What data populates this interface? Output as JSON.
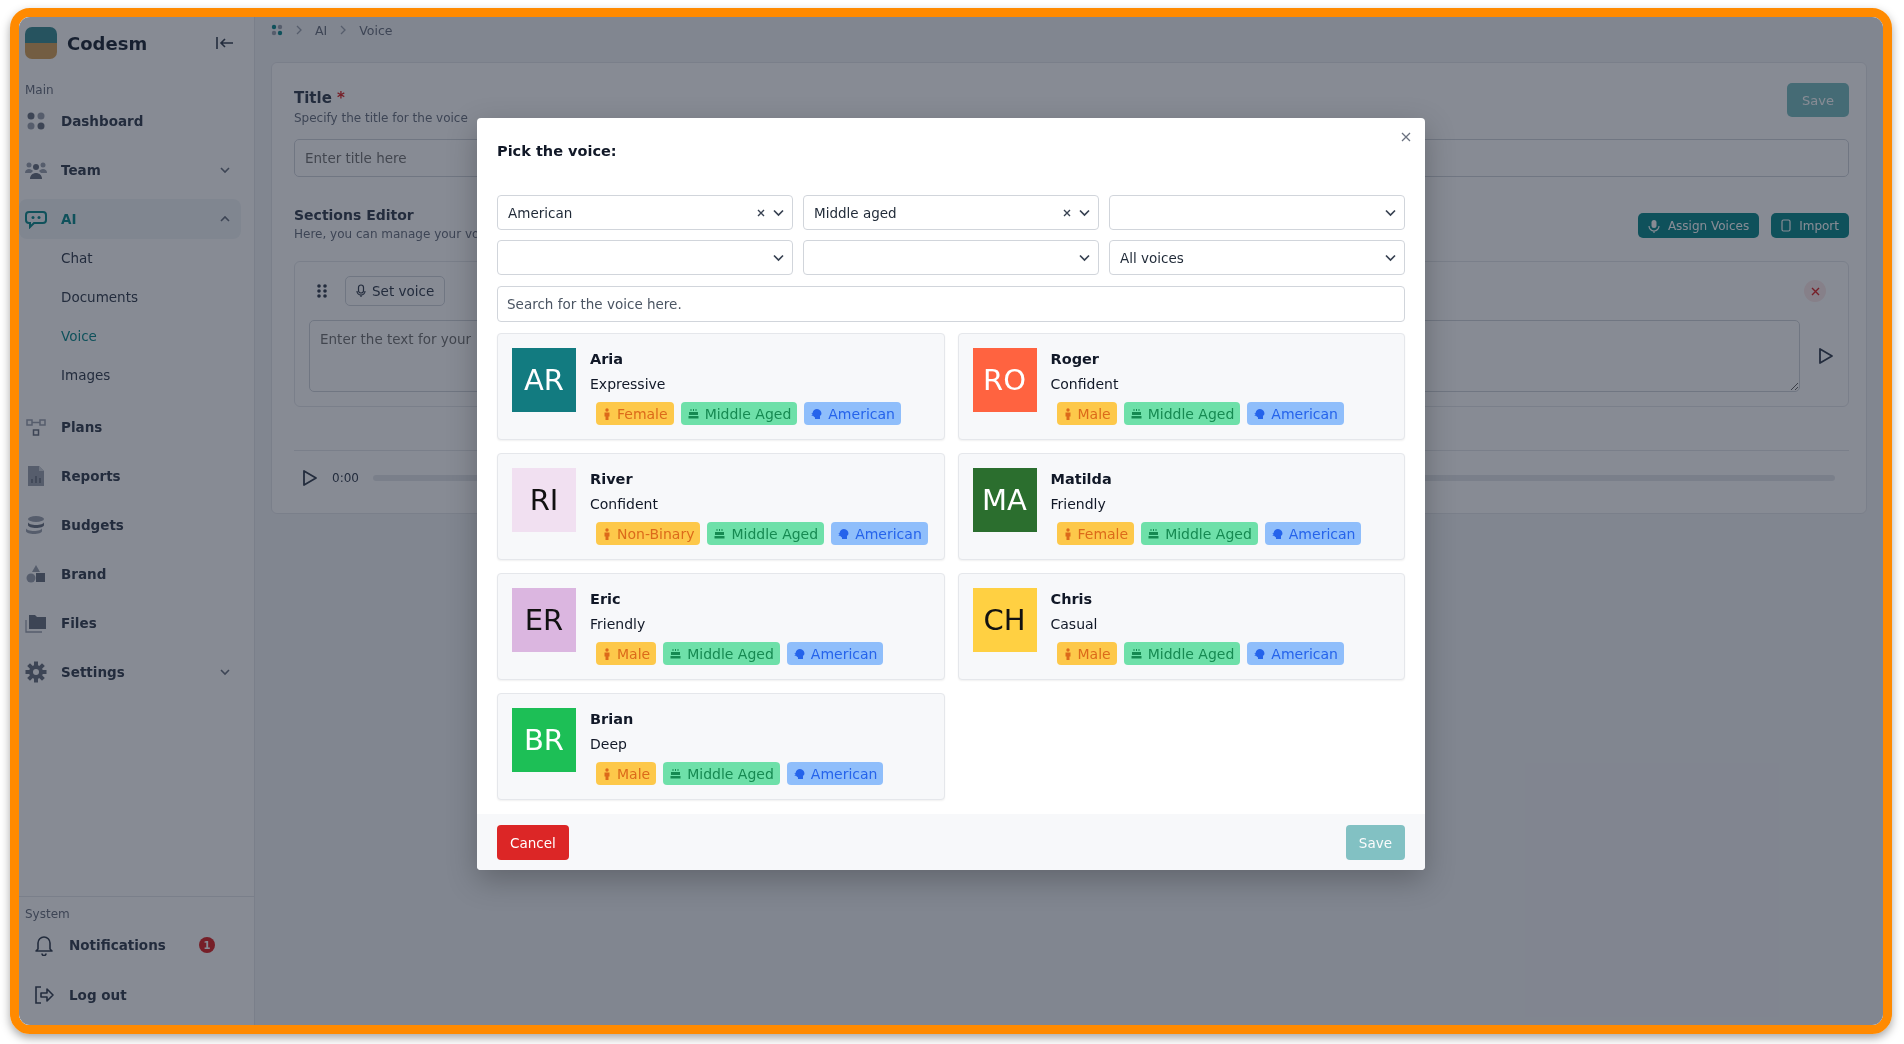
{
  "sidebar": {
    "brand": "Codesm",
    "sections": [
      {
        "title": "Main",
        "items": [
          {
            "label": "Dashboard",
            "selected": false
          },
          {
            "label": "Team",
            "selected": false,
            "expanded": false
          },
          {
            "label": "AI",
            "selected": true,
            "expanded": true,
            "children": [
              {
                "label": "Chat",
                "selected": false
              },
              {
                "label": "Documents",
                "selected": false
              },
              {
                "label": "Voice",
                "selected": true
              },
              {
                "label": "Images",
                "selected": false
              }
            ]
          },
          {
            "label": "Plans",
            "selected": false
          },
          {
            "label": "Reports",
            "selected": false
          },
          {
            "label": "Budgets",
            "selected": false
          },
          {
            "label": "Brand",
            "selected": false
          },
          {
            "label": "Files",
            "selected": false
          },
          {
            "label": "Settings",
            "selected": false,
            "expanded": false
          }
        ]
      },
      {
        "title": "System",
        "items": [
          {
            "label": "Notifications",
            "badge": "1"
          },
          {
            "label": "Log out"
          }
        ]
      }
    ]
  },
  "breadcrumb": [
    "AI",
    "Voice"
  ],
  "editor": {
    "title_label": "Title",
    "required_mark": "*",
    "title_hint": "Specify the title for the voice",
    "title_placeholder": "Enter title here",
    "save_button": "Save",
    "sections_title": "Sections Editor",
    "sections_hint": "Here, you can manage your vo",
    "assign_button": "Assign Voices",
    "import_button": "Import",
    "set_voice_button": "Set voice",
    "text_placeholder": "Enter the text for your",
    "time": "0:00"
  },
  "modal": {
    "title": "Pick the voice:",
    "filters": [
      {
        "value": "American",
        "clear_button": true
      },
      {
        "value": "Middle aged",
        "clear_button": true
      },
      {
        "clear_button": false
      },
      {
        "clear_button": false
      },
      {
        "clear_button": false
      },
      {
        "value": "All voices",
        "clear_button": false
      }
    ],
    "search_placeholder": "Search for the voice here.",
    "voices": [
      {
        "initials": "AR",
        "color": "#127b80",
        "name": "Aria",
        "style": "Expressive",
        "tags": [
          {
            "kind": "gender",
            "label": "Female"
          },
          {
            "kind": "age",
            "label": "Middle Aged"
          },
          {
            "kind": "accent",
            "label": "American"
          }
        ]
      },
      {
        "initials": "RO",
        "color": "#ff6340",
        "name": "Roger",
        "style": "Confident",
        "tags": [
          {
            "kind": "gender",
            "label": "Male"
          },
          {
            "kind": "age",
            "label": "Middle Aged"
          },
          {
            "kind": "accent",
            "label": "American"
          }
        ]
      },
      {
        "initials": "RI",
        "color": "#f1e0f1",
        "name": "River",
        "style": "Confident",
        "tags": [
          {
            "kind": "gender",
            "label": "Non-Binary"
          },
          {
            "kind": "age",
            "label": "Middle Aged"
          },
          {
            "kind": "accent",
            "label": "American"
          }
        ]
      },
      {
        "initials": "MA",
        "color": "#2b6e2e",
        "name": "Matilda",
        "style": "Friendly",
        "tags": [
          {
            "kind": "gender",
            "label": "Female"
          },
          {
            "kind": "age",
            "label": "Middle Aged"
          },
          {
            "kind": "accent",
            "label": "American"
          }
        ]
      },
      {
        "initials": "ER",
        "color": "#dbb6e0",
        "name": "Eric",
        "style": "Friendly",
        "tags": [
          {
            "kind": "gender",
            "label": "Male"
          },
          {
            "kind": "age",
            "label": "Middle Aged"
          },
          {
            "kind": "accent",
            "label": "American"
          }
        ]
      },
      {
        "initials": "CH",
        "color": "#ffd042",
        "name": "Chris",
        "style": "Casual",
        "tags": [
          {
            "kind": "gender",
            "label": "Male"
          },
          {
            "kind": "age",
            "label": "Middle Aged"
          },
          {
            "kind": "accent",
            "label": "American"
          }
        ]
      },
      {
        "initials": "BR",
        "color": "#1dbf56",
        "name": "Brian",
        "style": "Deep",
        "tags": [
          {
            "kind": "gender",
            "label": "Male"
          },
          {
            "kind": "age",
            "label": "Middle Aged"
          },
          {
            "kind": "accent",
            "label": "American"
          }
        ]
      }
    ],
    "cancel_button": "Cancel",
    "save_button": {
      "label": "Save",
      "disabled": true
    }
  }
}
